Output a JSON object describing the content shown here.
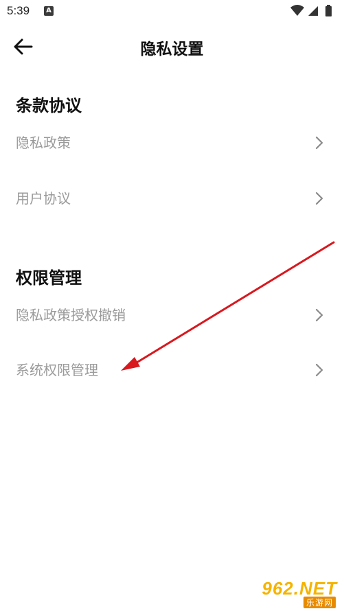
{
  "status_bar": {
    "time": "5:39",
    "app_icon_letter": "A"
  },
  "header": {
    "title": "隐私设置",
    "back_icon": "arrow-left-icon"
  },
  "sections": [
    {
      "title": "条款协议",
      "items": [
        {
          "label": "隐私政策"
        },
        {
          "label": "用户协议"
        }
      ]
    },
    {
      "title": "权限管理",
      "items": [
        {
          "label": "隐私政策授权撤销"
        },
        {
          "label": "系统权限管理"
        }
      ]
    }
  ],
  "annotation": {
    "color": "#d9181e",
    "points_to": "系统权限管理"
  },
  "watermark": {
    "top": "962.NET",
    "bottom": "乐游网"
  },
  "colors": {
    "item_text": "#9a9a9a",
    "title_text": "#111111",
    "chevron": "#8a8a8a"
  }
}
